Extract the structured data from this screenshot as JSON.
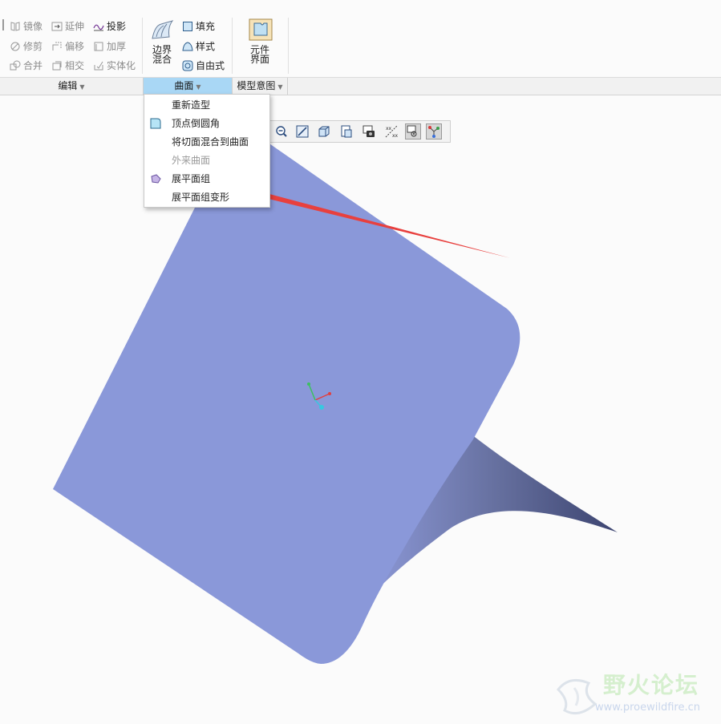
{
  "ribbon": {
    "edit_col1": [
      "镜像",
      "修剪",
      "合并"
    ],
    "edit_col2": [
      "延伸",
      "偏移",
      "相交"
    ],
    "edit_col3": [
      "投影",
      "加厚",
      "实体化"
    ],
    "boundary_blend": [
      "边界",
      "混合"
    ],
    "surface_small": [
      "填充",
      "样式",
      "自由式"
    ],
    "component_interface": [
      "元件",
      "界面"
    ]
  },
  "groups": {
    "edit": "编辑",
    "surface": "曲面",
    "model_intent": "模型意图"
  },
  "surface_menu": {
    "items": [
      "重新造型",
      "顶点倒圆角",
      "将切面混合到曲面",
      "外来曲面",
      "展平面组",
      "展平面组变形"
    ],
    "disabled": [
      "外来曲面"
    ]
  },
  "icons": {
    "view_toolbar": [
      "zoom-out-icon",
      "refit-icon",
      "display-style-icon",
      "saved-views-icon",
      "perspective-icon",
      "datum-display-icon",
      "annotation-display-icon",
      "spin-center-icon"
    ]
  },
  "colors": {
    "surface": "#8a98d9",
    "surface_dark": "#4e5a8c",
    "active_tab": "#a9d7f5",
    "arrow": "#e8403e"
  },
  "watermark": {
    "title": "野火论坛",
    "url": "www.proewildfire.cn"
  }
}
